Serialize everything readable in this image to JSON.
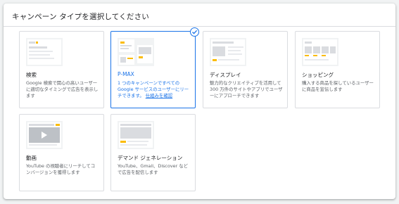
{
  "header": {
    "title": "キャンペーン タイプを選択してください"
  },
  "colors": {
    "accent": "#1a73e8",
    "placeholder_yellow": "#fbbc04",
    "placeholder_gray": "#dadce0"
  },
  "cards": [
    {
      "title": "検索",
      "desc": "Google 検索で関心の高いユーザーに適切なタイミングで広告を表示します",
      "icon": "search-ad-thumbnail-icon"
    },
    {
      "title": "P-MAX",
      "desc": "1 つのキャンペーンですべての Google サービスのユーザーにリーチできます。",
      "link": "仕組みを確認",
      "icon": "pmax-thumbnail-icon",
      "selected": true
    },
    {
      "title": "ディスプレイ",
      "desc": "魅力的なクリエイティブを活用して 300 万件のサイトやアプリでユーザーにアプローチできます",
      "icon": "display-thumbnail-icon"
    },
    {
      "title": "ショッピング",
      "desc": "購入する商品を探しているユーザーに商品を宣伝します",
      "icon": "shopping-thumbnail-icon"
    },
    {
      "title": "動画",
      "desc": "YouTube の視聴者にリーチしてコンバージョンを獲得します",
      "icon": "video-thumbnail-icon"
    },
    {
      "title": "デマンド ジェネレーション",
      "desc": "YouTube、Gmail、Discover などで広告を配信します",
      "icon": "demand-gen-thumbnail-icon"
    }
  ]
}
